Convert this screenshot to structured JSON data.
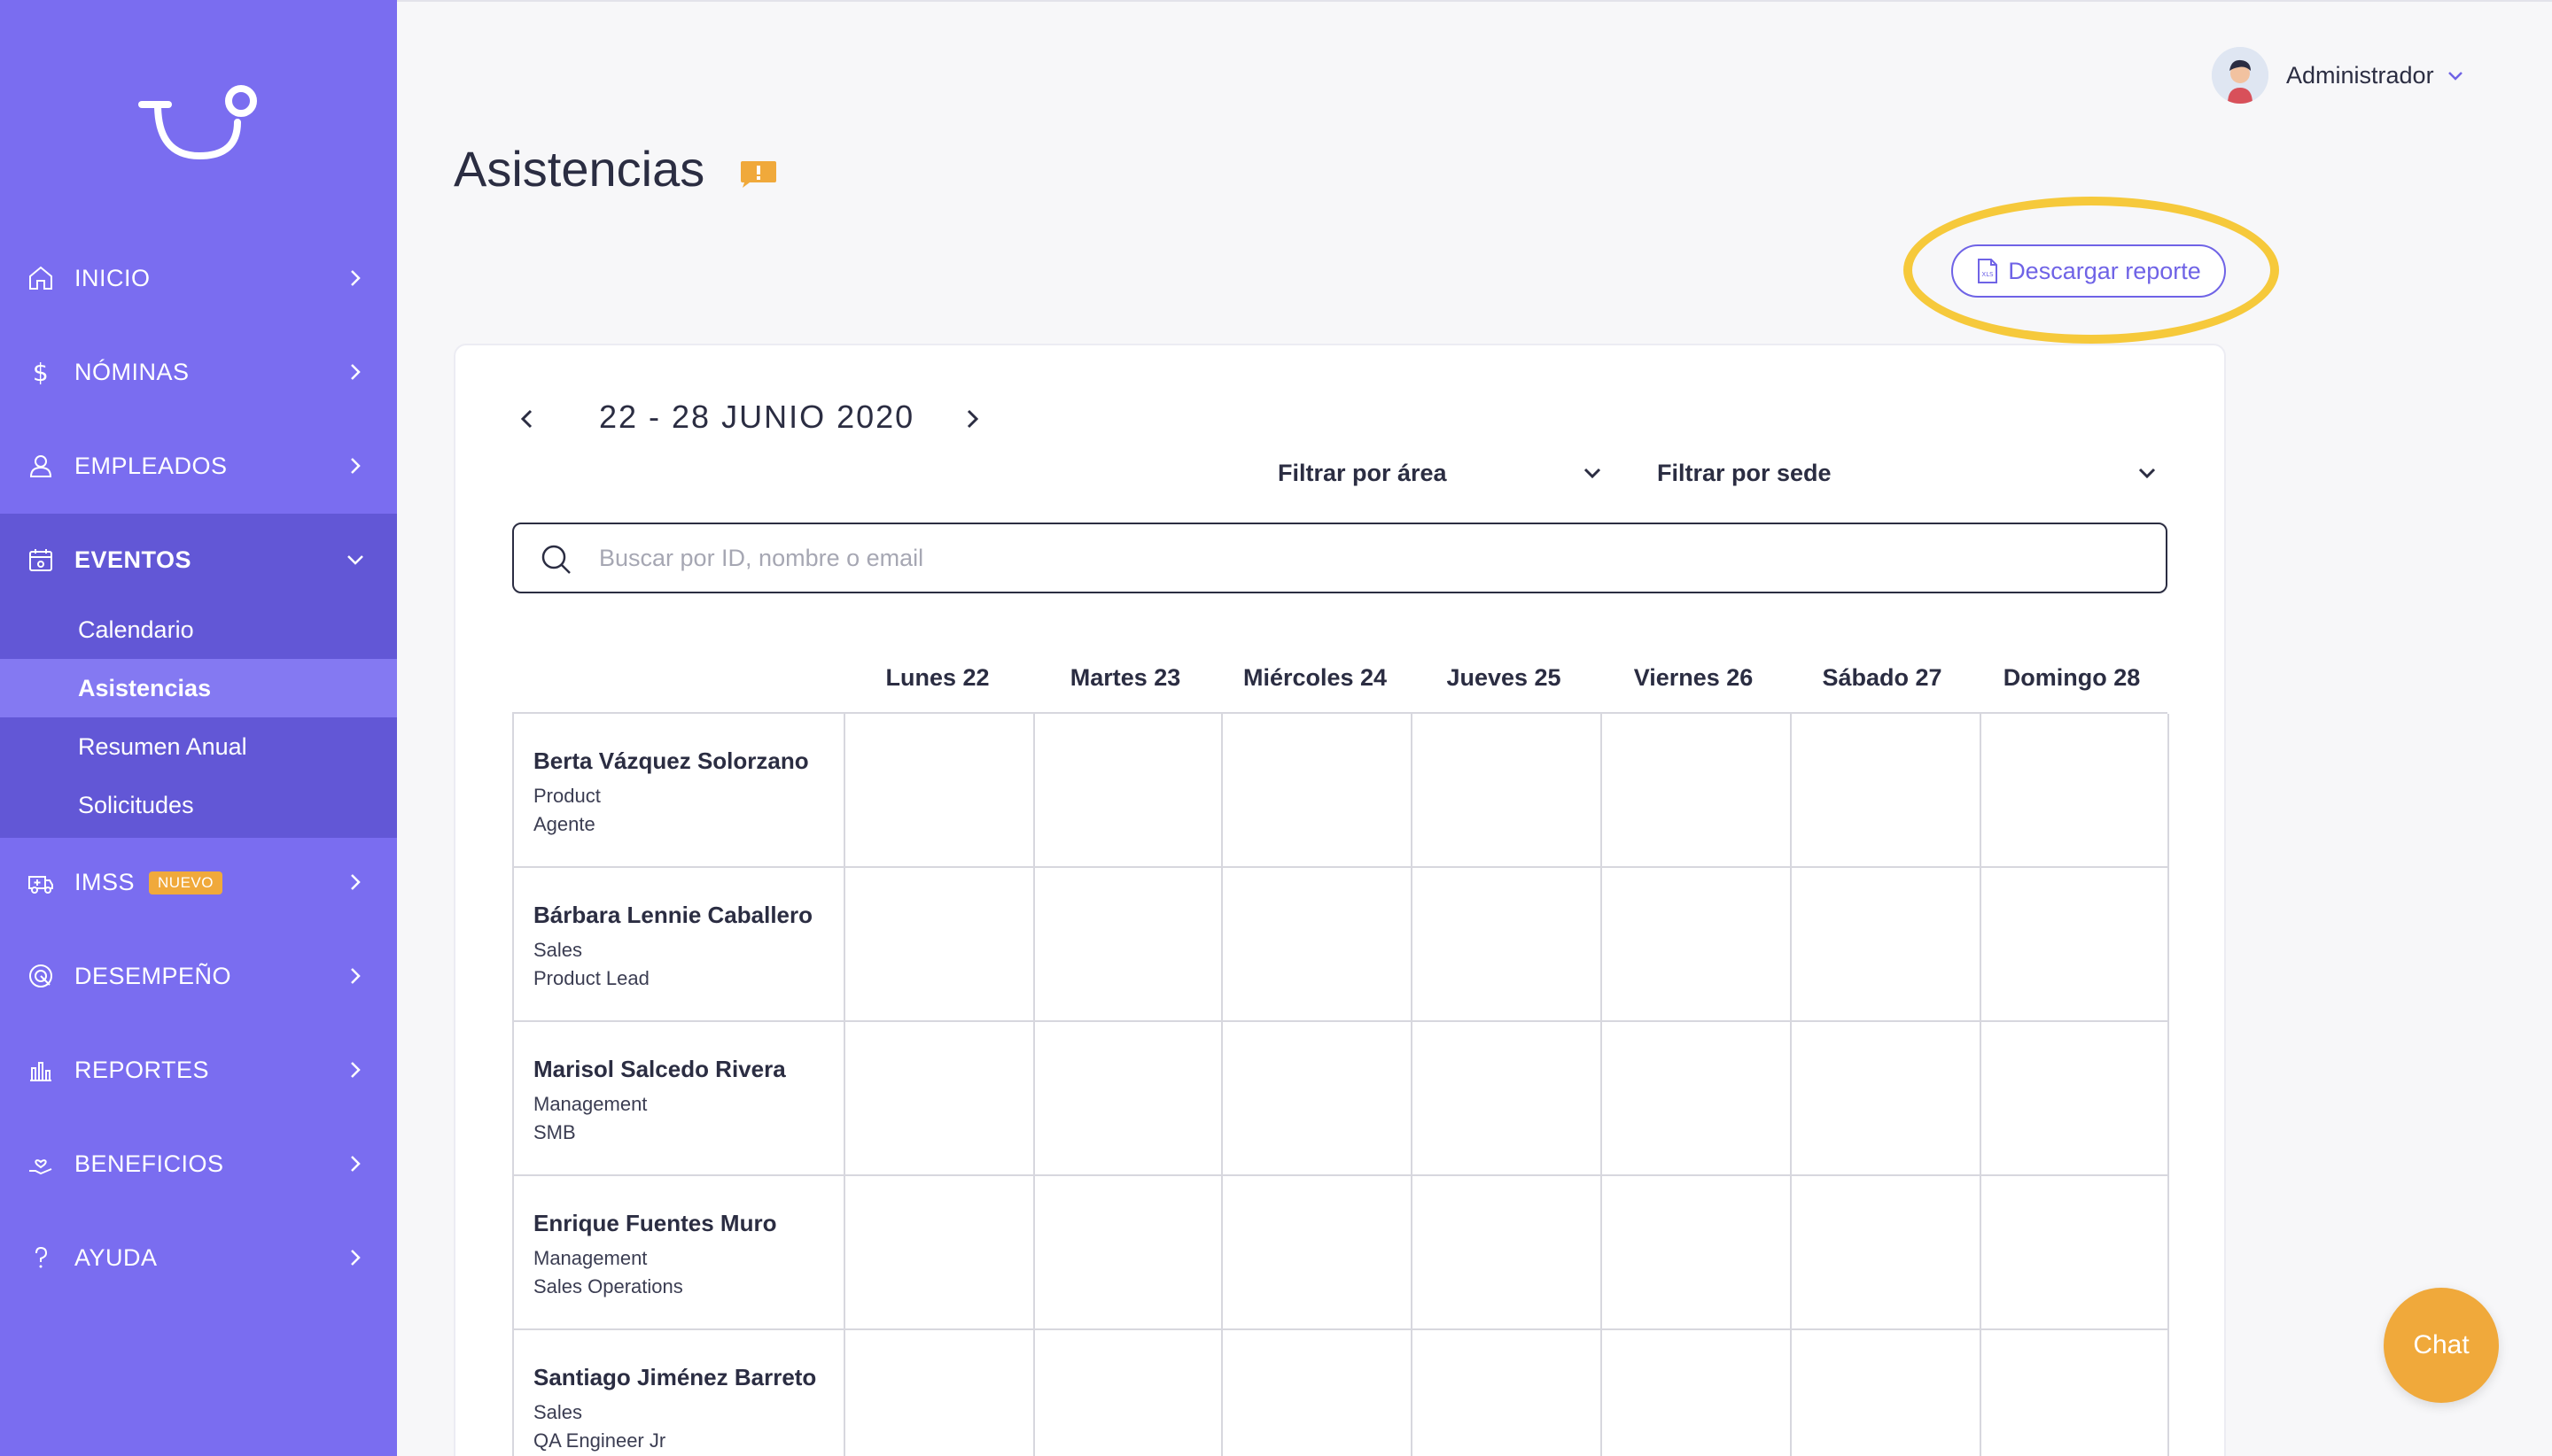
{
  "sidebar": {
    "items": [
      {
        "label": "INICIO",
        "icon": "home-icon"
      },
      {
        "label": "NÓMINAS",
        "icon": "dollar-icon"
      },
      {
        "label": "EMPLEADOS",
        "icon": "user-icon"
      },
      {
        "label": "EVENTOS",
        "icon": "calendar-icon"
      },
      {
        "label": "IMSS",
        "icon": "ambulance-icon",
        "badge": "NUEVO"
      },
      {
        "label": "DESEMPEÑO",
        "icon": "target-icon"
      },
      {
        "label": "REPORTES",
        "icon": "bar-chart-icon"
      },
      {
        "label": "BENEFICIOS",
        "icon": "hand-heart-icon"
      },
      {
        "label": "AYUDA",
        "icon": "question-icon"
      }
    ],
    "submenu": [
      "Calendario",
      "Asistencias",
      "Resumen Anual",
      "Solicitudes"
    ]
  },
  "header": {
    "user_name": "Administrador"
  },
  "page": {
    "title": "Asistencias",
    "download_label": "Descargar reporte"
  },
  "calendar": {
    "week_label": "22 - 28 JUNIO 2020",
    "filter_area": "Filtrar por área",
    "filter_sede": "Filtrar por sede",
    "search_placeholder": "Buscar por ID, nombre o email",
    "days": [
      "Lunes 22",
      "Martes 23",
      "Miércoles 24",
      "Jueves 25",
      "Viernes 26",
      "Sábado 27",
      "Domingo 28"
    ]
  },
  "employees": [
    {
      "name": "Berta Vázquez Solorzano",
      "area": "Product",
      "role": "Agente"
    },
    {
      "name": "Bárbara Lennie Caballero",
      "area": "Sales",
      "role": "Product Lead"
    },
    {
      "name": "Marisol Salcedo Rivera",
      "area": "Management",
      "role": "SMB"
    },
    {
      "name": "Enrique Fuentes Muro",
      "area": "Management",
      "role": "Sales Operations"
    },
    {
      "name": "Santiago Jiménez Barreto",
      "area": "Sales",
      "role": "QA Engineer Jr"
    }
  ],
  "chat": {
    "label": "Chat"
  },
  "colors": {
    "sidebar": "#7a6df0",
    "sidebar_active": "#6257d6",
    "accent": "#6f63e6",
    "highlight": "#f6c93b",
    "chat": "#f0a93b"
  }
}
